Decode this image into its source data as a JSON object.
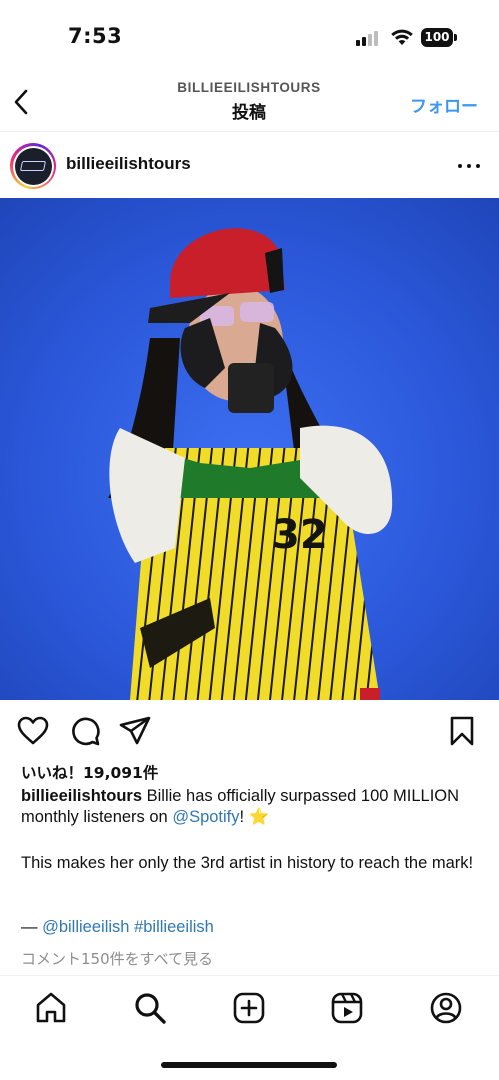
{
  "status_bar": {
    "time": "7:53",
    "battery": "100",
    "icons": [
      "signal-icon",
      "wifi-icon",
      "battery-icon"
    ]
  },
  "header": {
    "account": "BILLIEEILISHTOURS",
    "title": "投稿",
    "follow_label": "フォロー",
    "back_icon": "chevron-left-icon"
  },
  "post": {
    "username": "billieeilishtours",
    "more_icon": "more-horizontal-icon",
    "image_description_icon": "post-photo",
    "actions": [
      "heart-icon",
      "comment-icon",
      "share-icon",
      "bookmark-icon"
    ],
    "likes": "いいね！19,091件",
    "caption": {
      "user": "billieeilishtours",
      "text_before": " Billie has officially surpassed 100 MILLION monthly listeners on ",
      "mention": "@Spotify",
      "text_after": "! ⭐",
      "paragraph": "This makes her only the 3rd artist in history to reach the mark!",
      "dash": "— ",
      "credit_mention": "@billieeilish",
      "hashtag": "#billieeilish"
    },
    "comments_link": "コメント150件をすべて見る"
  },
  "tab_bar": {
    "items": [
      "home-icon",
      "search-icon",
      "create-icon",
      "reels-icon",
      "profile-icon"
    ]
  },
  "colors": {
    "accent_blue": "#3d97f0",
    "mention_blue": "#2f78b5",
    "muted_gray": "#8e8e8e",
    "photo_background": "#2f5fe0"
  }
}
